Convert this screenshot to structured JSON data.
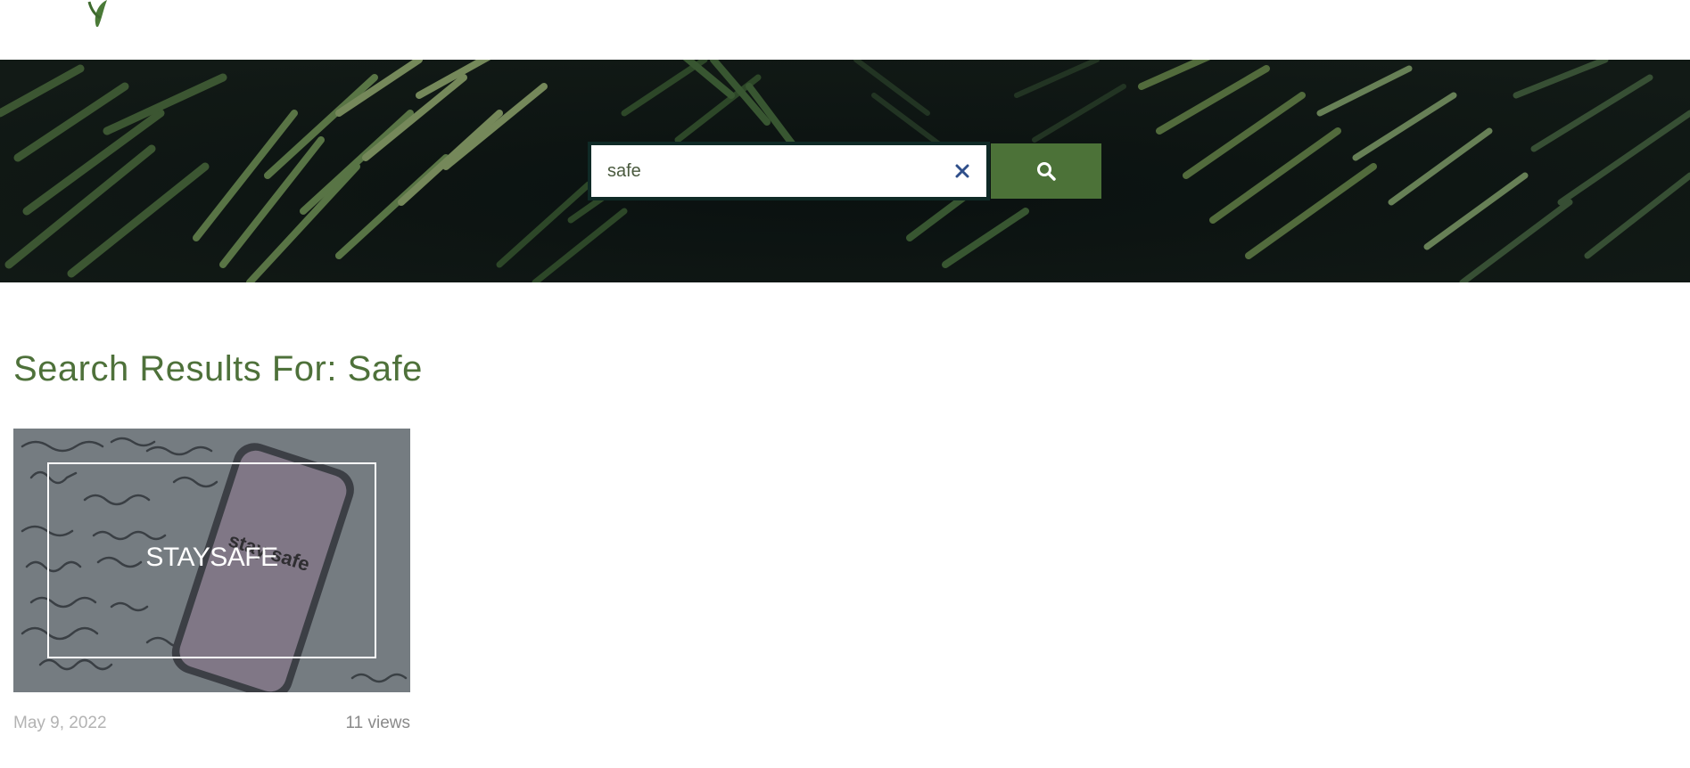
{
  "search": {
    "value": "safe",
    "clear_icon": "close-icon",
    "submit_icon": "search-icon"
  },
  "results": {
    "title": "Search Results For: Safe",
    "items": [
      {
        "title": "STAYSAFE",
        "date": "May 9, 2022",
        "views": "11 views",
        "image_text": "stay safe"
      }
    ]
  },
  "colors": {
    "accent": "#4c7238",
    "title": "#4e713a",
    "clear_icon": "#2f4f8a"
  }
}
